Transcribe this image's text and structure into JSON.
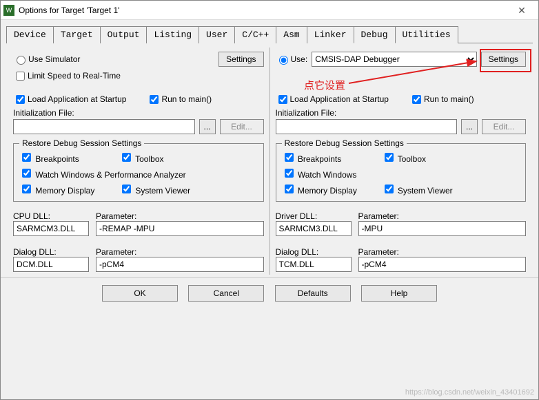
{
  "window": {
    "title": "Options for Target 'Target 1'"
  },
  "tabs": [
    "Device",
    "Target",
    "Output",
    "Listing",
    "User",
    "C/C++",
    "Asm",
    "Linker",
    "Debug",
    "Utilities"
  ],
  "active_tab": "Debug",
  "left": {
    "use_simulator": "Use Simulator",
    "settings_btn": "Settings",
    "limit_speed": "Limit Speed to Real-Time",
    "load_startup": "Load Application at Startup",
    "run_main": "Run to main()",
    "init_file_lbl": "Initialization File:",
    "init_file_val": "",
    "browse": "...",
    "edit": "Edit...",
    "restore_legend": "Restore Debug Session Settings",
    "breakpoints": "Breakpoints",
    "toolbox": "Toolbox",
    "watch_perf": "Watch Windows & Performance Analyzer",
    "memory": "Memory Display",
    "sysview": "System Viewer",
    "cpu_dll_lbl": "CPU DLL:",
    "cpu_param_lbl": "Parameter:",
    "cpu_dll_val": "SARMCM3.DLL",
    "cpu_param_val": "-REMAP -MPU",
    "dlg_dll_lbl": "Dialog DLL:",
    "dlg_param_lbl": "Parameter:",
    "dlg_dll_val": "DCM.DLL",
    "dlg_param_val": "-pCM4"
  },
  "right": {
    "use_lbl": "Use:",
    "debugger_sel": "CMSIS-DAP Debugger",
    "settings_btn": "Settings",
    "load_startup": "Load Application at Startup",
    "run_main": "Run to main()",
    "init_file_lbl": "Initialization File:",
    "init_file_val": "",
    "browse": "...",
    "edit": "Edit...",
    "restore_legend": "Restore Debug Session Settings",
    "breakpoints": "Breakpoints",
    "toolbox": "Toolbox",
    "watch": "Watch Windows",
    "memory": "Memory Display",
    "sysview": "System Viewer",
    "drv_dll_lbl": "Driver DLL:",
    "drv_param_lbl": "Parameter:",
    "drv_dll_val": "SARMCM3.DLL",
    "drv_param_val": "-MPU",
    "dlg_dll_lbl": "Dialog DLL:",
    "dlg_param_lbl": "Parameter:",
    "dlg_dll_val": "TCM.DLL",
    "dlg_param_val": "-pCM4"
  },
  "buttons": {
    "ok": "OK",
    "cancel": "Cancel",
    "defaults": "Defaults",
    "help": "Help"
  },
  "annotation": {
    "text": "点它设置"
  },
  "watermark": "https://blog.csdn.net/weixin_43401692"
}
